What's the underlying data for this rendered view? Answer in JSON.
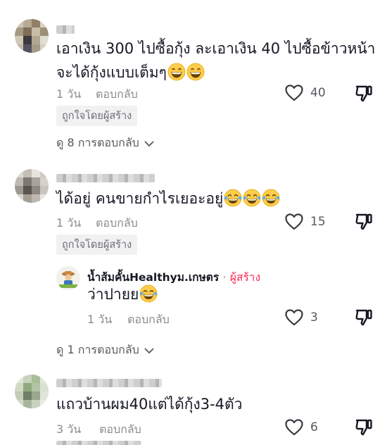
{
  "comments": [
    {
      "text": "เอาเงิน 300 ไปซื้อกุ้ง ละเอาเงิน 40 ไปซื้อข้าวหน้า",
      "text_line2": "จะได้กุ้งแบบเต็มๆ",
      "emoji": "grinning-emoji",
      "time": "1 วัน",
      "reply_label": "ตอบกลับ",
      "likes": "40",
      "badge": "ถูกใจโดยผู้สร้าง",
      "view_replies": "ดู 8 การตอบกลับ"
    },
    {
      "text": "ได้อยู่ คนขายกำไรเยอะอยู่",
      "emoji": "tears-of-joy-emoji",
      "time": "1 วัน",
      "reply_label": "ตอบกลับ",
      "likes": "15",
      "badge": "ถูกใจโดยผู้สร้าง",
      "view_replies": "ดู 1 การตอบกลับ"
    },
    {
      "text": "แถวบ้านผม40แต่ได้กุ้ง3-4ตัว",
      "time": "3 วัน",
      "reply_label": "ตอบกลับ",
      "likes": "6"
    }
  ],
  "creator_reply": {
    "name": "น้ำส้มคั้นHealthyม.เกษตร",
    "separator": "·",
    "creator_label": "ผู้สร้าง",
    "text": "ว่าปายย",
    "time": "1 วัน",
    "reply_label": "ตอบกลับ",
    "likes": "3"
  },
  "colors": {
    "creator_accent": "#fe2c55",
    "meta": "#8a8b91",
    "emoji_yellow": "#ffcc4d"
  },
  "icons": [
    "heart-outline-icon",
    "dislike-icon",
    "chevron-down-icon",
    "grinning-emoji",
    "tears-of-joy-emoji"
  ]
}
